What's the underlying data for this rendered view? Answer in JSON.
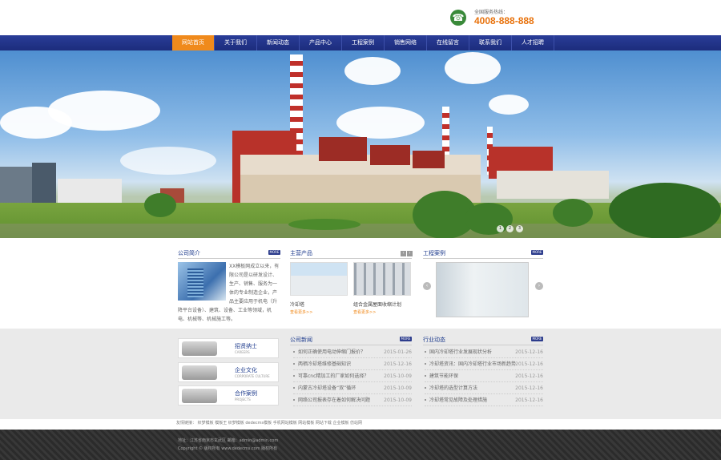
{
  "header": {
    "hotline_label": "全国服务热线：",
    "hotline_number": "4008-888-888"
  },
  "nav": {
    "items": [
      "网站首页",
      "关于我们",
      "新闻动态",
      "产品中心",
      "工程案例",
      "销售网络",
      "在线留言",
      "联系我们",
      "人才招聘"
    ],
    "active_index": 0
  },
  "banner": {
    "pager": [
      "1",
      "2",
      "3"
    ]
  },
  "about": {
    "title": "公司简介",
    "more": "MORE",
    "text": "XX模板网成立以来，有限公司是以研发设计、生产、销售、服务为一体的专业制造企业，产品主要应用于机电（升降平台设备）、建筑、设备、工业等领域，机电、机械等、机械施工等。"
  },
  "products": {
    "title": "主营产品",
    "more_arrows": [
      "‹",
      "›"
    ],
    "items": [
      {
        "name": "冷却塔",
        "more": "查看更多>>"
      },
      {
        "name": "组合金属屋面收缩计划",
        "more": "查看更多>>"
      }
    ]
  },
  "cases": {
    "title": "工程案例",
    "more": "MORE",
    "prev": "‹",
    "next": "›"
  },
  "side_buttons": [
    {
      "title": "招贤纳士",
      "subtitle": "CAREERS"
    },
    {
      "title": "企业文化",
      "subtitle": "CORPORATE CULTURE"
    },
    {
      "title": "合作案例",
      "subtitle": "PROJECTS"
    }
  ],
  "company_news": {
    "title": "公司新闻",
    "more": "MORE",
    "items": [
      {
        "title": "如何正确使用电动伸缩门报价？",
        "date": "2015-01-26"
      },
      {
        "title": "两栖冷却塔维修基础知识",
        "date": "2015-12-16"
      },
      {
        "title": "可靠cnc精加工的厂家如何选择？",
        "date": "2015-10-09"
      },
      {
        "title": "内蒙古冷却塔设备“双”循环",
        "date": "2015-10-09"
      },
      {
        "title": "网络公司报表存在着如何解决问题",
        "date": "2015-10-09"
      }
    ]
  },
  "industry_news": {
    "title": "行业动态",
    "more": "MORE",
    "items": [
      {
        "title": "国内冷却塔行业发展现状分析",
        "date": "2015-12-16"
      },
      {
        "title": "冷却塔资讯：国内冷却塔行业市场新趋势",
        "date": "2015-12-16"
      },
      {
        "title": "建筑节能环保",
        "date": "2015-12-16"
      },
      {
        "title": "冷却塔的选型计算方法",
        "date": "2015-12-16"
      },
      {
        "title": "冷却塔常见故障及处理措施",
        "date": "2015-12-16"
      }
    ]
  },
  "links": {
    "label": "友情链接：",
    "text": "织梦模板  模板王  织梦模板  dedecms模板  手机网站模板  网站模板  网站下载  企业模板  仿站网"
  },
  "footer": {
    "line1": "地址：江苏省南京市玄武区 邮箱：admin@admin.com",
    "line2": "Copyright © 版权所有 www.dedecms.com 版权所有"
  },
  "colors": {
    "nav_bg": "#1c2c7c",
    "nav_active": "#f08a1c",
    "hotline": "#e8720c",
    "section_title": "#1c3a8c"
  }
}
